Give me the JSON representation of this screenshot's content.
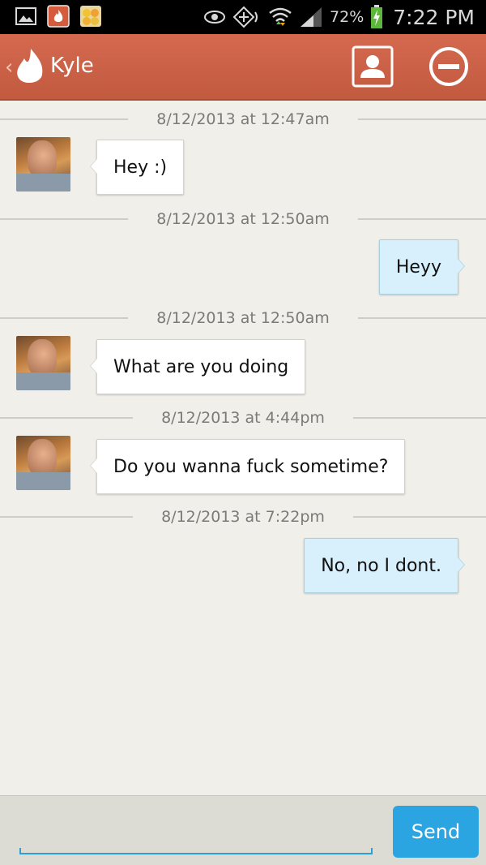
{
  "status_bar": {
    "battery": "72%",
    "time": "7:22 PM",
    "icons": [
      "gallery-icon",
      "tinder-notification-icon",
      "emoji-app-icon",
      "eye-icon",
      "nfc-icon",
      "wifi-icon",
      "signal-icon",
      "battery-charging-icon"
    ]
  },
  "header": {
    "title": "Kyle",
    "accent": "#c9614a",
    "icons": [
      "back-chevron-icon",
      "flame-icon",
      "profile-icon",
      "block-icon"
    ]
  },
  "messages": [
    {
      "timestamp": "8/12/2013 at 12:47am",
      "from": "them",
      "text": "Hey :)"
    },
    {
      "timestamp": "8/12/2013 at 12:50am",
      "from": "me",
      "text": "Heyy"
    },
    {
      "timestamp": "8/12/2013 at 12:50am",
      "from": "them",
      "text": "What are you doing"
    },
    {
      "timestamp": "8/12/2013 at 4:44pm",
      "from": "them",
      "text": "Do you wanna fuck sometime?"
    },
    {
      "timestamp": "8/12/2013 at 7:22pm",
      "from": "me",
      "text": "No, no I dont."
    }
  ],
  "composer": {
    "value": "",
    "send_label": "Send",
    "send_color": "#2ba5e2"
  }
}
